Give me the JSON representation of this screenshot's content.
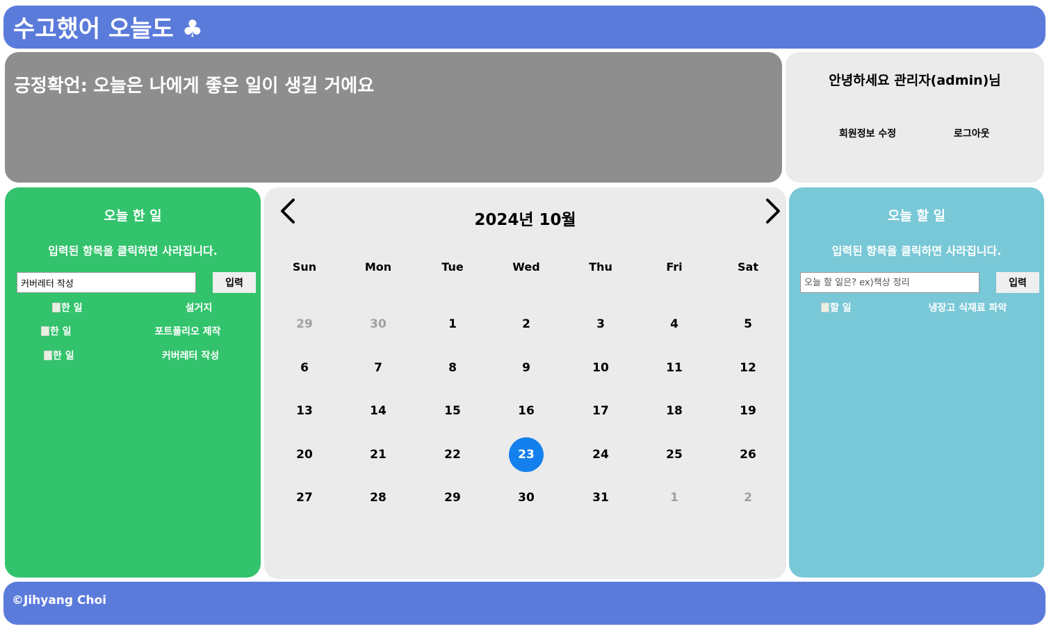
{
  "header": {
    "title": "수고했어 오늘도 ♣"
  },
  "affirmation": {
    "label": "긍정확언:",
    "text": "오늘은 나에게 좋은 일이 생길 거에요"
  },
  "user": {
    "greeting": "안녕하세요 관리자(admin)님",
    "edit_link": "회원정보 수정",
    "logout_link": "로그아웃"
  },
  "done_panel": {
    "title": "오늘 한 일",
    "hint": "입력된 항목을 클릭하면 사라집니다.",
    "input_value": "커버레터 작성",
    "button_label": "입력",
    "items": [
      {
        "img_alt": "한 일",
        "text": "설거지"
      },
      {
        "img_alt": "한 일",
        "text": "포트폴리오 제작"
      },
      {
        "img_alt": "한 일",
        "text": "커버레터 작성"
      }
    ]
  },
  "todo_panel": {
    "title": "오늘 할 일",
    "hint": "입력된 항목을 클릭하면 사라집니다.",
    "input_placeholder": "오늘 할 일은? ex)책상 정리",
    "button_label": "입력",
    "items": [
      {
        "img_alt": "할 일",
        "text": "냉장고 식재료 파악"
      }
    ]
  },
  "calendar": {
    "month_title": "2024년 10월",
    "weekdays": [
      "Sun",
      "Mon",
      "Tue",
      "Wed",
      "Thu",
      "Fri",
      "Sat"
    ],
    "today": "23",
    "weeks": [
      [
        "29",
        "30",
        "1",
        "2",
        "3",
        "4",
        "5"
      ],
      [
        "6",
        "7",
        "8",
        "9",
        "10",
        "11",
        "12"
      ],
      [
        "13",
        "14",
        "15",
        "16",
        "17",
        "18",
        "19"
      ],
      [
        "20",
        "21",
        "22",
        "23",
        "24",
        "25",
        "26"
      ],
      [
        "27",
        "28",
        "29",
        "30",
        "31",
        "1",
        "2"
      ]
    ],
    "other_month_days": [
      [
        0,
        0
      ],
      [
        0,
        1
      ],
      [
        4,
        5
      ],
      [
        4,
        6
      ]
    ],
    "prev_icon": "chevron-left-icon",
    "next_icon": "chevron-right-icon"
  },
  "footer": {
    "copyright": "©Jihyang Choi"
  },
  "colors": {
    "header": "#5b7bdb",
    "done": "#32c36c",
    "todo": "#79c8d7",
    "affirmation": "#8e8e8e",
    "today": "#1380ee"
  }
}
